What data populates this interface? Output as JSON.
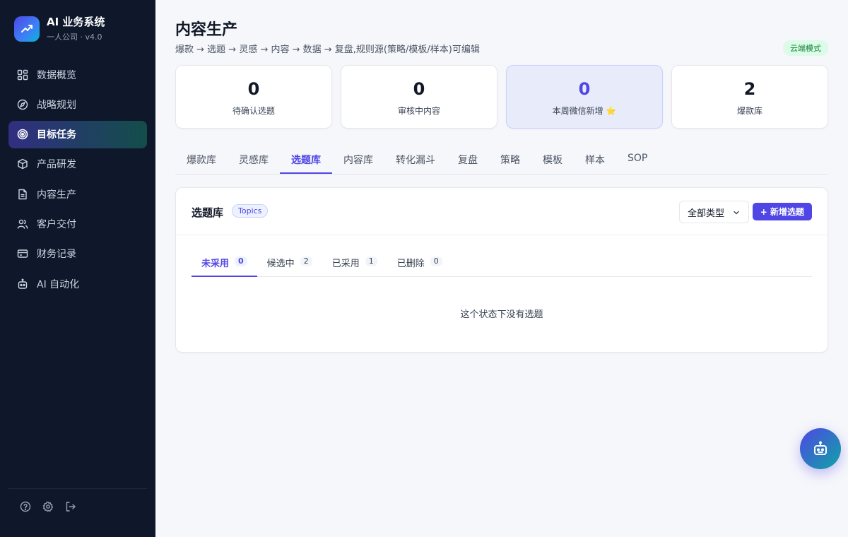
{
  "app": {
    "title": "AI 业务系统",
    "subtitle": "一人公司 · v4.0"
  },
  "sidebar": {
    "items": [
      {
        "label": "数据概览",
        "icon": "dashboard-icon"
      },
      {
        "label": "战略规划",
        "icon": "compass-icon"
      },
      {
        "label": "目标任务",
        "icon": "target-icon",
        "active": true
      },
      {
        "label": "产品研发",
        "icon": "box-icon"
      },
      {
        "label": "内容生产",
        "icon": "document-icon"
      },
      {
        "label": "客户交付",
        "icon": "users-icon"
      },
      {
        "label": "财务记录",
        "icon": "credit-card-icon"
      },
      {
        "label": "AI 自动化",
        "icon": "robot-icon"
      }
    ],
    "footer_icons": [
      "help-icon",
      "gear-icon",
      "logout-icon"
    ]
  },
  "header": {
    "title": "内容生产",
    "breadcrumb": "爆款 → 选题 → 灵感 → 内容 → 数据 → 复盘,规则源(策略/模板/样本)可编辑",
    "mode_badge": "云端模式"
  },
  "stats": [
    {
      "value": "0",
      "label": "待确认选题"
    },
    {
      "value": "0",
      "label": "审核中内容"
    },
    {
      "value": "0",
      "label": "本周微信新增 ⭐"
    },
    {
      "value": "2",
      "label": "爆款库"
    }
  ],
  "tabs": [
    "爆款库",
    "灵感库",
    "选题库",
    "内容库",
    "转化漏斗",
    "复盘",
    "策略",
    "模板",
    "样本",
    "SOP"
  ],
  "active_tab": "选题库",
  "card": {
    "title": "选题库",
    "tag": "Topics",
    "filter_value": "全部类型",
    "add_label": "+ 新增选题",
    "subtabs": [
      {
        "label": "未采用",
        "count": "0"
      },
      {
        "label": "候选中",
        "count": "2"
      },
      {
        "label": "已采用",
        "count": "1"
      },
      {
        "label": "已删除",
        "count": "0"
      }
    ],
    "empty_text": "这个状态下没有选题"
  },
  "colors": {
    "accent": "#4f46e5",
    "sidebar_bg": "#0f172a",
    "page_bg": "#f6f7fb",
    "badge_green": "#15803d"
  }
}
